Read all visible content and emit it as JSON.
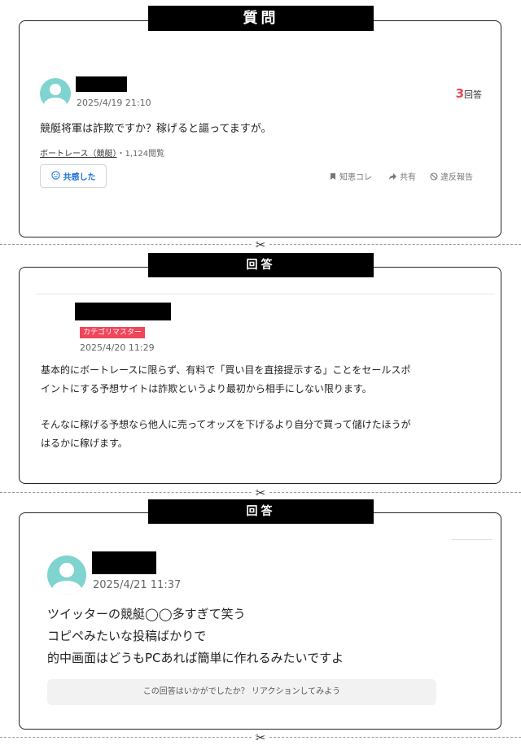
{
  "question": {
    "header": "質問",
    "date": "2025/4/19 21:10",
    "answer_count": "3",
    "answer_count_unit": "回答",
    "body": "競艇将軍は詐欺ですか？稼げると謳ってますが。",
    "category": "ボートレース（競艇）",
    "views": "・1,124閲覧",
    "empathy_button": "共感した",
    "actions": {
      "bookmark": "知恵コレ",
      "share": "共有",
      "report": "違反報告"
    }
  },
  "answer1": {
    "header": "回答",
    "badge": "カテゴリマスター",
    "date": "2025/4/20 11:29",
    "para1_line1": "基本的にボートレースに限らず、有料で「買い目を直接提示する」ことをセールスポ",
    "para1_line2": "イントにする予想サイトは詐欺というより最初から相手にしない限ります。",
    "para2_line1": "そんなに稼げる予想なら他人に売ってオッズを下げるより自分で買って儲けたほうが",
    "para2_line2": "はるかに稼げます。"
  },
  "answer2": {
    "header": "回答",
    "date": "2025/4/21 11:37",
    "line1": "ツイッターの競艇◯◯多すぎて笑う",
    "line2": "コピペみたいな投稿ばかりで",
    "line3": "的中画面はどうもPCあれば簡単に作れるみたいですよ",
    "reaction_prompt": "この回答はいかがでしたか？ リアクションしてみよう"
  },
  "colors": {
    "accent_red": "#e8464f",
    "badge_bg": "#f0465a",
    "link_blue": "#1a6fd6",
    "avatar": "#7fd4d0"
  }
}
